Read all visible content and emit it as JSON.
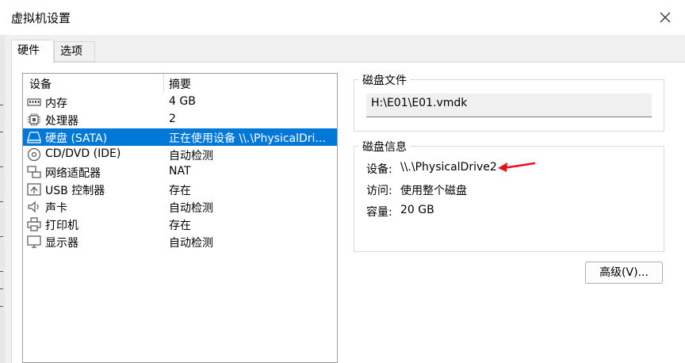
{
  "window": {
    "title": "虚拟机设置"
  },
  "tabs": [
    {
      "label": "硬件",
      "active": true
    },
    {
      "label": "选项",
      "active": false
    }
  ],
  "device_list": {
    "headers": {
      "device": "设备",
      "summary": "摘要"
    },
    "rows": [
      {
        "icon": "memory-icon",
        "name": "内存",
        "summary": "4 GB"
      },
      {
        "icon": "processor-icon",
        "name": "处理器",
        "summary": "2"
      },
      {
        "icon": "hard-disk-icon",
        "name": "硬盘 (SATA)",
        "summary": "正在使用设备 \\\\.\\PhysicalDri...",
        "selected": true
      },
      {
        "icon": "cd-dvd-icon",
        "name": "CD/DVD (IDE)",
        "summary": "自动检测"
      },
      {
        "icon": "network-adapter-icon",
        "name": "网络适配器",
        "summary": "NAT"
      },
      {
        "icon": "usb-icon",
        "name": "USB 控制器",
        "summary": "存在"
      },
      {
        "icon": "sound-card-icon",
        "name": "声卡",
        "summary": "自动检测"
      },
      {
        "icon": "printer-icon",
        "name": "打印机",
        "summary": "存在"
      },
      {
        "icon": "display-icon",
        "name": "显示器",
        "summary": "自动检测"
      }
    ]
  },
  "disk_file": {
    "title": "磁盘文件",
    "path": "H:\\E01\\E01.vmdk"
  },
  "disk_info": {
    "title": "磁盘信息",
    "device_label": "设备:",
    "device_value": "\\\\.\\PhysicalDrive2",
    "access_label": "访问:",
    "access_value": "使用整个磁盘",
    "capacity_label": "容量:",
    "capacity_value": "20 GB"
  },
  "advanced_button": {
    "label": "高级(V)..."
  },
  "colors": {
    "selection": "#0078d7",
    "annotation_arrow": "#e8101e"
  }
}
